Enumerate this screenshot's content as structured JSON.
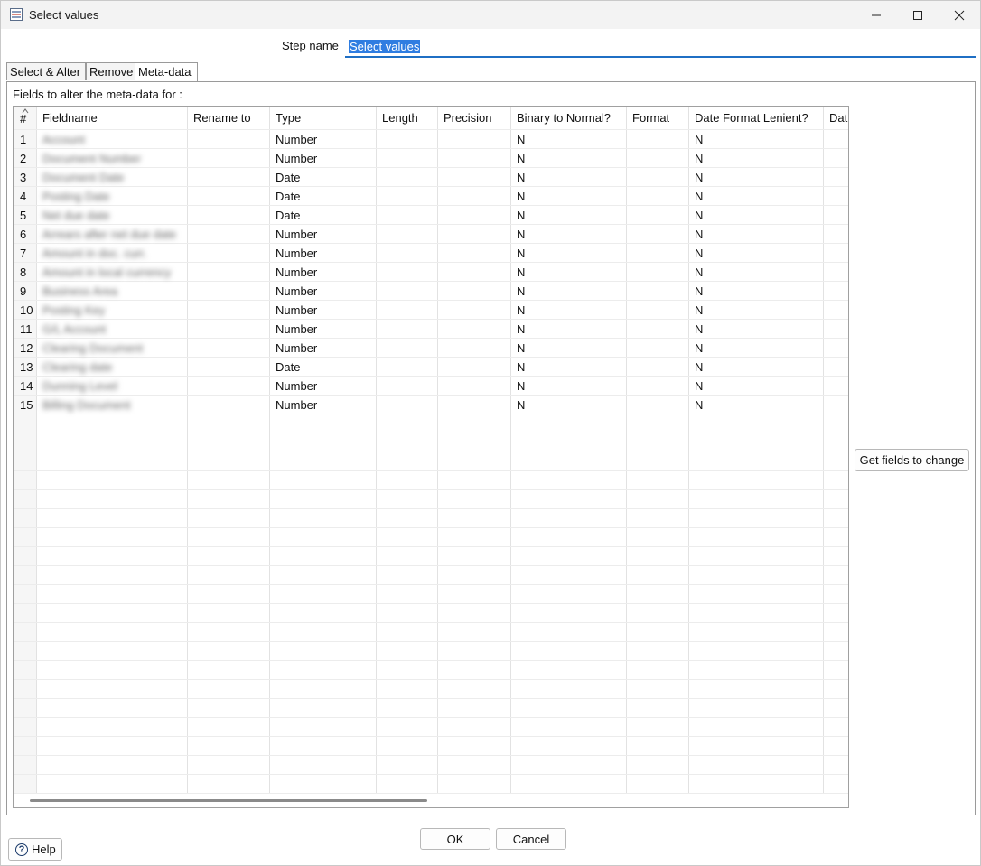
{
  "window": {
    "title": "Select values"
  },
  "step_name": {
    "label": "Step name",
    "value": "Select values"
  },
  "tabs": [
    {
      "label": "Select & Alter"
    },
    {
      "label": "Remove"
    },
    {
      "label": "Meta-data"
    }
  ],
  "active_tab": "Meta-data",
  "fields_label": "Fields to alter the meta-data for :",
  "grid": {
    "columns": [
      "#",
      "Fieldname",
      "Rename to",
      "Type",
      "Length",
      "Precision",
      "Binary to Normal?",
      "Format",
      "Date Format Lenient?",
      "Dat"
    ],
    "rows": [
      {
        "n": "1",
        "fieldname": "Account",
        "type": "Number",
        "binary": "N",
        "lenient": "N"
      },
      {
        "n": "2",
        "fieldname": "Document Number",
        "type": "Number",
        "binary": "N",
        "lenient": "N"
      },
      {
        "n": "3",
        "fieldname": "Document Date",
        "type": "Date",
        "binary": "N",
        "lenient": "N"
      },
      {
        "n": "4",
        "fieldname": "Posting Date",
        "type": "Date",
        "binary": "N",
        "lenient": "N"
      },
      {
        "n": "5",
        "fieldname": "Net due date",
        "type": "Date",
        "binary": "N",
        "lenient": "N"
      },
      {
        "n": "6",
        "fieldname": "Arrears after net due date",
        "type": "Number",
        "binary": "N",
        "lenient": "N"
      },
      {
        "n": "7",
        "fieldname": "Amount in doc. curr.",
        "type": "Number",
        "binary": "N",
        "lenient": "N"
      },
      {
        "n": "8",
        "fieldname": "Amount in local currency",
        "type": "Number",
        "binary": "N",
        "lenient": "N"
      },
      {
        "n": "9",
        "fieldname": "Business Area",
        "type": "Number",
        "binary": "N",
        "lenient": "N"
      },
      {
        "n": "10",
        "fieldname": "Posting Key",
        "type": "Number",
        "binary": "N",
        "lenient": "N"
      },
      {
        "n": "11",
        "fieldname": "G/L Account",
        "type": "Number",
        "binary": "N",
        "lenient": "N"
      },
      {
        "n": "12",
        "fieldname": "Clearing Document",
        "type": "Number",
        "binary": "N",
        "lenient": "N"
      },
      {
        "n": "13",
        "fieldname": "Clearing date",
        "type": "Date",
        "binary": "N",
        "lenient": "N"
      },
      {
        "n": "14",
        "fieldname": "Dunning Level",
        "type": "Number",
        "binary": "N",
        "lenient": "N"
      },
      {
        "n": "15",
        "fieldname": "Billing Document",
        "type": "Number",
        "binary": "N",
        "lenient": "N"
      }
    ]
  },
  "buttons": {
    "get_fields": "Get fields to change",
    "ok": "OK",
    "cancel": "Cancel",
    "help": "Help"
  },
  "icons": {
    "app": "select-values-step-icon",
    "minimize": "minimize-icon",
    "maximize": "maximize-icon",
    "close": "close-icon",
    "help": "help-circle-icon",
    "sort": "sort-ascending-icon"
  },
  "colors": {
    "selection": "#2f7de1",
    "focus_underline": "#1f6fc4"
  }
}
